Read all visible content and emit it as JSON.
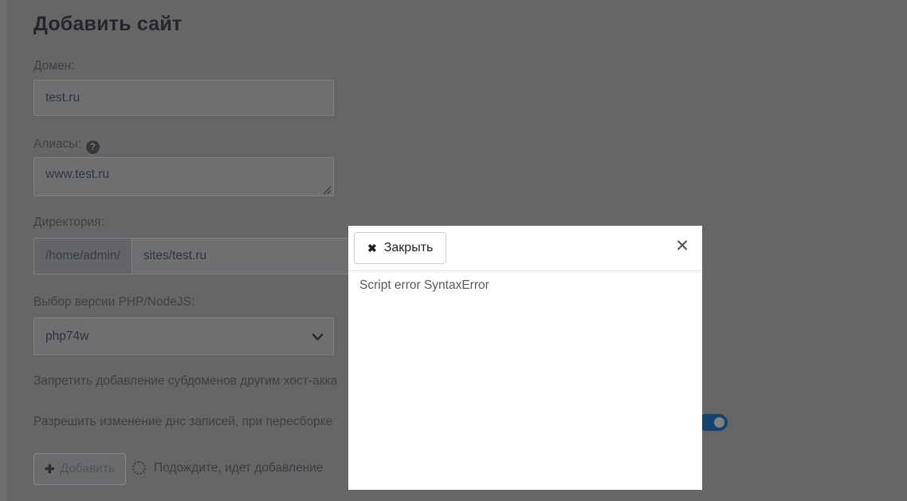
{
  "page": {
    "title": "Добавить сайт",
    "form": {
      "domain": {
        "label": "Домен:",
        "value": "test.ru"
      },
      "aliases": {
        "label": "Алиасы:",
        "value": "www.test.ru"
      },
      "directory": {
        "label": "Директория:",
        "prefix": "/home/admin/",
        "value": "sites/test.ru"
      },
      "php_version": {
        "label": "Выбор версии PHP/NodeJS:",
        "selected": "php74w"
      },
      "options": [
        {
          "label": "Запретить добавление субдоменов другим хост-акка",
          "toggle_visible": false
        },
        {
          "label": "Разрешить изменение днс записей, при пересборке",
          "toggle_visible": true,
          "toggle_on": true
        }
      ],
      "submit": {
        "label": "Добавить",
        "plus_glyph": "✚",
        "disabled": true
      },
      "progress_text": "Подождите, идет добавление"
    }
  },
  "modal": {
    "close_button_label": "Закрыть",
    "close_button_glyph": "✖",
    "corner_close_glyph": "✕",
    "body_text": "Script error SyntaxError"
  },
  "colors": {
    "backdrop_gray": "#666667",
    "toggle_accent": "#15436b",
    "modal_background": "#ffffff",
    "modal_divider": "#e2e4e7",
    "title_text": "#23262b"
  }
}
